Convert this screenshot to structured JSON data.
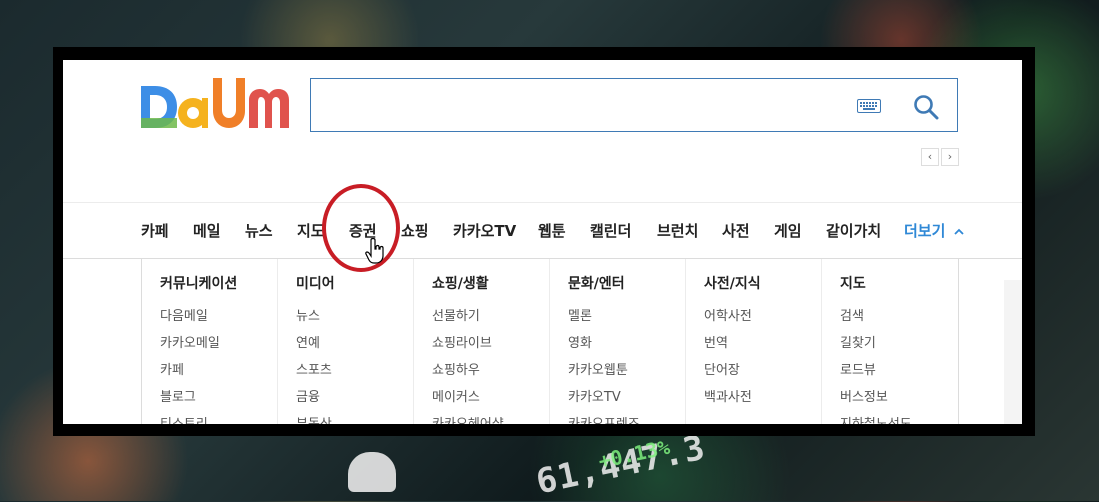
{
  "search": {
    "placeholder": ""
  },
  "nav": {
    "items": [
      {
        "label": "카페"
      },
      {
        "label": "메일"
      },
      {
        "label": "뉴스"
      },
      {
        "label": "지도"
      },
      {
        "label": "증권"
      },
      {
        "label": "쇼핑"
      },
      {
        "label": "카카오TV"
      },
      {
        "label": "웹툰"
      },
      {
        "label": "캘린더"
      },
      {
        "label": "브런치"
      },
      {
        "label": "사전"
      },
      {
        "label": "게임"
      },
      {
        "label": "같이가치"
      }
    ],
    "more_label": "더보기",
    "highlighted": "증권"
  },
  "menu": {
    "columns": [
      {
        "title": "커뮤니케이션",
        "links": [
          "다음메일",
          "카카오메일",
          "카페",
          "블로그",
          "티스토리"
        ]
      },
      {
        "title": "미디어",
        "links": [
          "뉴스",
          "연예",
          "스포츠",
          "금융",
          "부동산"
        ]
      },
      {
        "title": "쇼핑/생활",
        "links": [
          "선물하기",
          "쇼핑라이브",
          "쇼핑하우",
          "메이커스",
          "카카오헤어샵"
        ]
      },
      {
        "title": "문화/엔터",
        "links": [
          "멜론",
          "영화",
          "카카오웹툰",
          "카카오TV",
          "카카오프렌즈"
        ]
      },
      {
        "title": "사전/지식",
        "links": [
          "어학사전",
          "번역",
          "단어장",
          "백과사전"
        ]
      },
      {
        "title": "지도",
        "links": [
          "검색",
          "길찾기",
          "로드뷰",
          "버스정보",
          "지하철노선도"
        ]
      }
    ]
  },
  "background": {
    "ticker_text": "61,447.3",
    "change_text": "+0.13%"
  },
  "colors": {
    "accent": "#2f88d6",
    "highlight_circle": "#c81d25",
    "search_border": "#3f7ab5"
  },
  "icons": {
    "logo": "daum-logo",
    "keyboard": "keyboard-icon",
    "search": "search-icon",
    "cursor": "hand-cursor-icon"
  }
}
